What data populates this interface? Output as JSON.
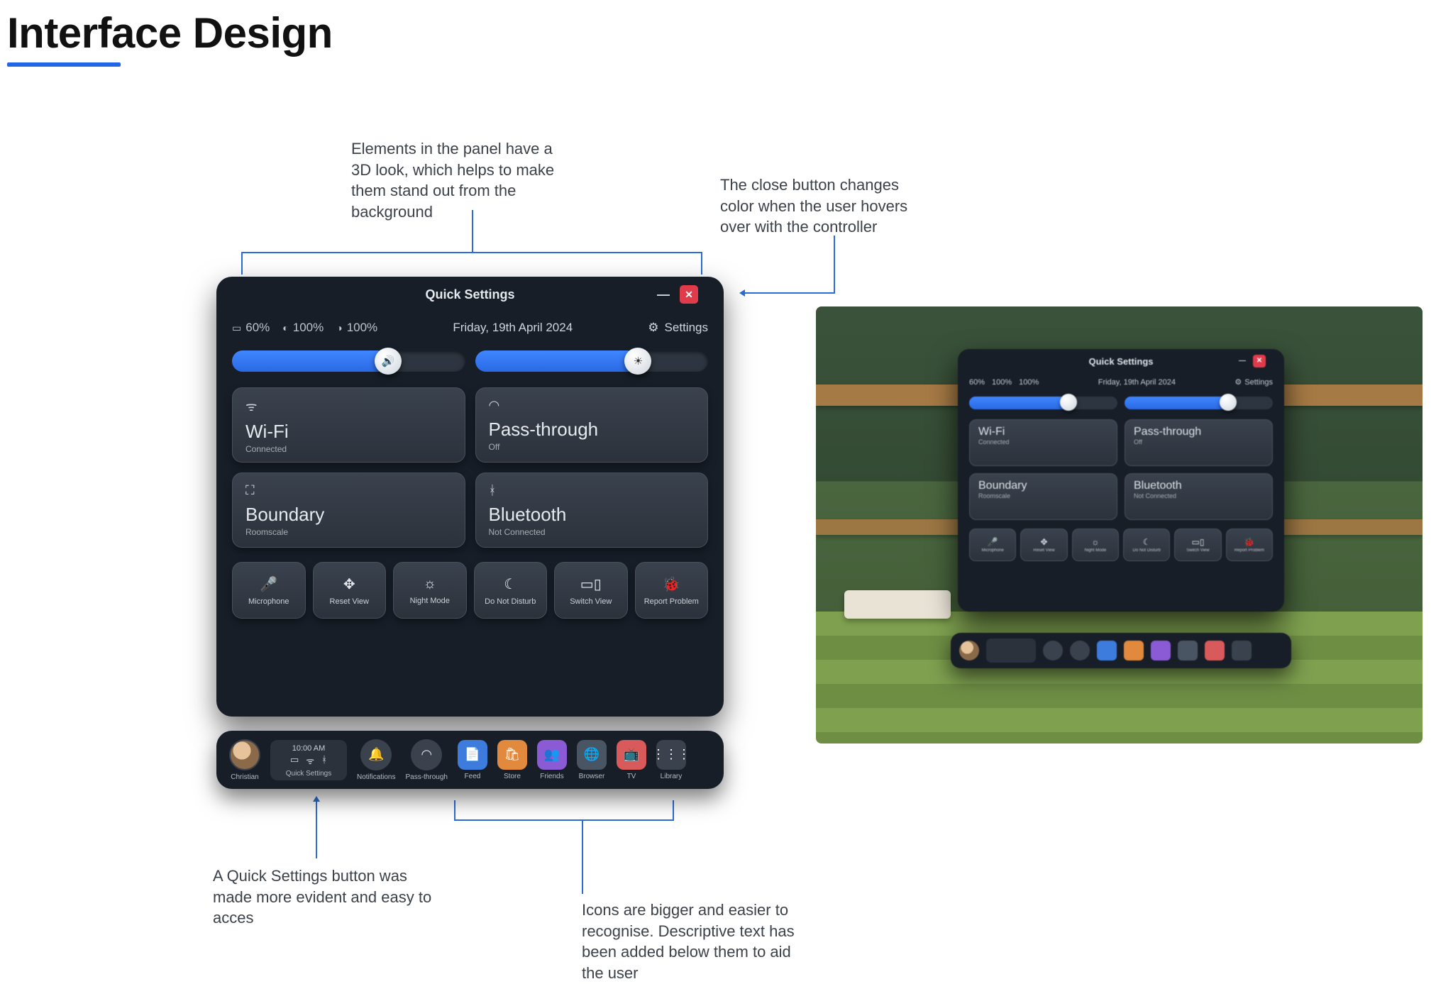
{
  "page": {
    "title": "Interface Design"
  },
  "annotations": {
    "top_left": "Elements in the panel have a 3D look, which helps to make them stand out from the background",
    "top_right": "The close button changes color when the user hovers over with the controller",
    "bottom_left": "A Quick Settings button was made more evident and easy to acces",
    "bottom_right": "Icons are bigger and easier to recognise. Descriptive text has been added below them to aid the user"
  },
  "panel": {
    "title": "Quick Settings",
    "date": "Friday, 19th April 2024",
    "settings_label": "Settings",
    "status": {
      "battery": "60%",
      "left_controller": "100%",
      "right_controller": "100%"
    },
    "sliders": {
      "volume_pct": 67,
      "brightness_pct": 70
    },
    "tiles": [
      {
        "icon": "wifi-icon",
        "title": "Wi-Fi",
        "sub": "Connected"
      },
      {
        "icon": "headset-icon",
        "title": "Pass-through",
        "sub": "Off"
      },
      {
        "icon": "boundary-icon",
        "title": "Boundary",
        "sub": "Roomscale"
      },
      {
        "icon": "bluetooth-icon",
        "title": "Bluetooth",
        "sub": "Not Connected"
      }
    ],
    "buttons": [
      {
        "icon": "microphone-icon",
        "label": "Microphone"
      },
      {
        "icon": "reset-view-icon",
        "label": "Reset View"
      },
      {
        "icon": "night-mode-icon",
        "label": "Night Mode"
      },
      {
        "icon": "dnd-icon",
        "label": "Do Not Disturb"
      },
      {
        "icon": "switch-view-icon",
        "label": "Switch View"
      },
      {
        "icon": "bug-icon",
        "label": "Report Problem"
      }
    ]
  },
  "taskbar": {
    "user_name": "Christian",
    "time": "10:00 AM",
    "qs_label": "Quick Settings",
    "items": [
      {
        "id": "notifications",
        "label": "Notifications",
        "style": "round",
        "icon": "bell-icon",
        "color": "#3a424d"
      },
      {
        "id": "passthrough",
        "label": "Pass-through",
        "style": "round",
        "icon": "headset-icon",
        "color": "#3a424d"
      },
      {
        "id": "feed",
        "label": "Feed",
        "style": "square",
        "icon": "feed-icon",
        "color": "#3d7bdc"
      },
      {
        "id": "store",
        "label": "Store",
        "style": "square",
        "icon": "bag-icon",
        "color": "#e1893d"
      },
      {
        "id": "friends",
        "label": "Friends",
        "style": "square",
        "icon": "people-icon",
        "color": "#8b5bd6"
      },
      {
        "id": "browser",
        "label": "Browser",
        "style": "square",
        "icon": "globe-icon",
        "color": "#4a5564"
      },
      {
        "id": "tv",
        "label": "TV",
        "style": "square",
        "icon": "tv-icon",
        "color": "#d95a5a"
      },
      {
        "id": "library",
        "label": "Library",
        "style": "square",
        "icon": "grid-icon",
        "color": "#3a424d"
      }
    ]
  },
  "vr_panel": {
    "title": "Quick Settings",
    "date": "Friday, 19th April 2024",
    "settings_label": "Settings",
    "status": {
      "battery": "60%",
      "left_controller": "100%",
      "right_controller": "100%"
    },
    "sliders": {
      "volume_pct": 67,
      "brightness_pct": 70
    },
    "tiles": [
      {
        "title": "Wi-Fi",
        "sub": "Connected"
      },
      {
        "title": "Pass-through",
        "sub": "Off"
      },
      {
        "title": "Boundary",
        "sub": "Roomscale"
      },
      {
        "title": "Bluetooth",
        "sub": "Not Connected"
      }
    ],
    "buttons": [
      {
        "label": "Microphone"
      },
      {
        "label": "Reset View"
      },
      {
        "label": "Night Mode"
      },
      {
        "label": "Do Not Disturb"
      },
      {
        "label": "Switch View"
      },
      {
        "label": "Report Problem"
      }
    ]
  },
  "icon_glyphs": {
    "battery-icon": "▭",
    "controller-l-icon": "◐",
    "controller-r-icon": "◑",
    "gear-icon": "⚙",
    "volume-icon": "🔊",
    "brightness-icon": "☀",
    "wifi-icon": "ᯤ",
    "headset-icon": "◠",
    "boundary-icon": "⛶",
    "bluetooth-icon": "ᚼ",
    "microphone-icon": "🎤",
    "reset-view-icon": "✥",
    "night-mode-icon": "☼",
    "dnd-icon": "☾",
    "switch-view-icon": "▭▯",
    "bug-icon": "🐞",
    "bell-icon": "🔔",
    "feed-icon": "📄",
    "bag-icon": "🛍",
    "people-icon": "👥",
    "globe-icon": "🌐",
    "tv-icon": "📺",
    "grid-icon": "⋮⋮⋮"
  }
}
